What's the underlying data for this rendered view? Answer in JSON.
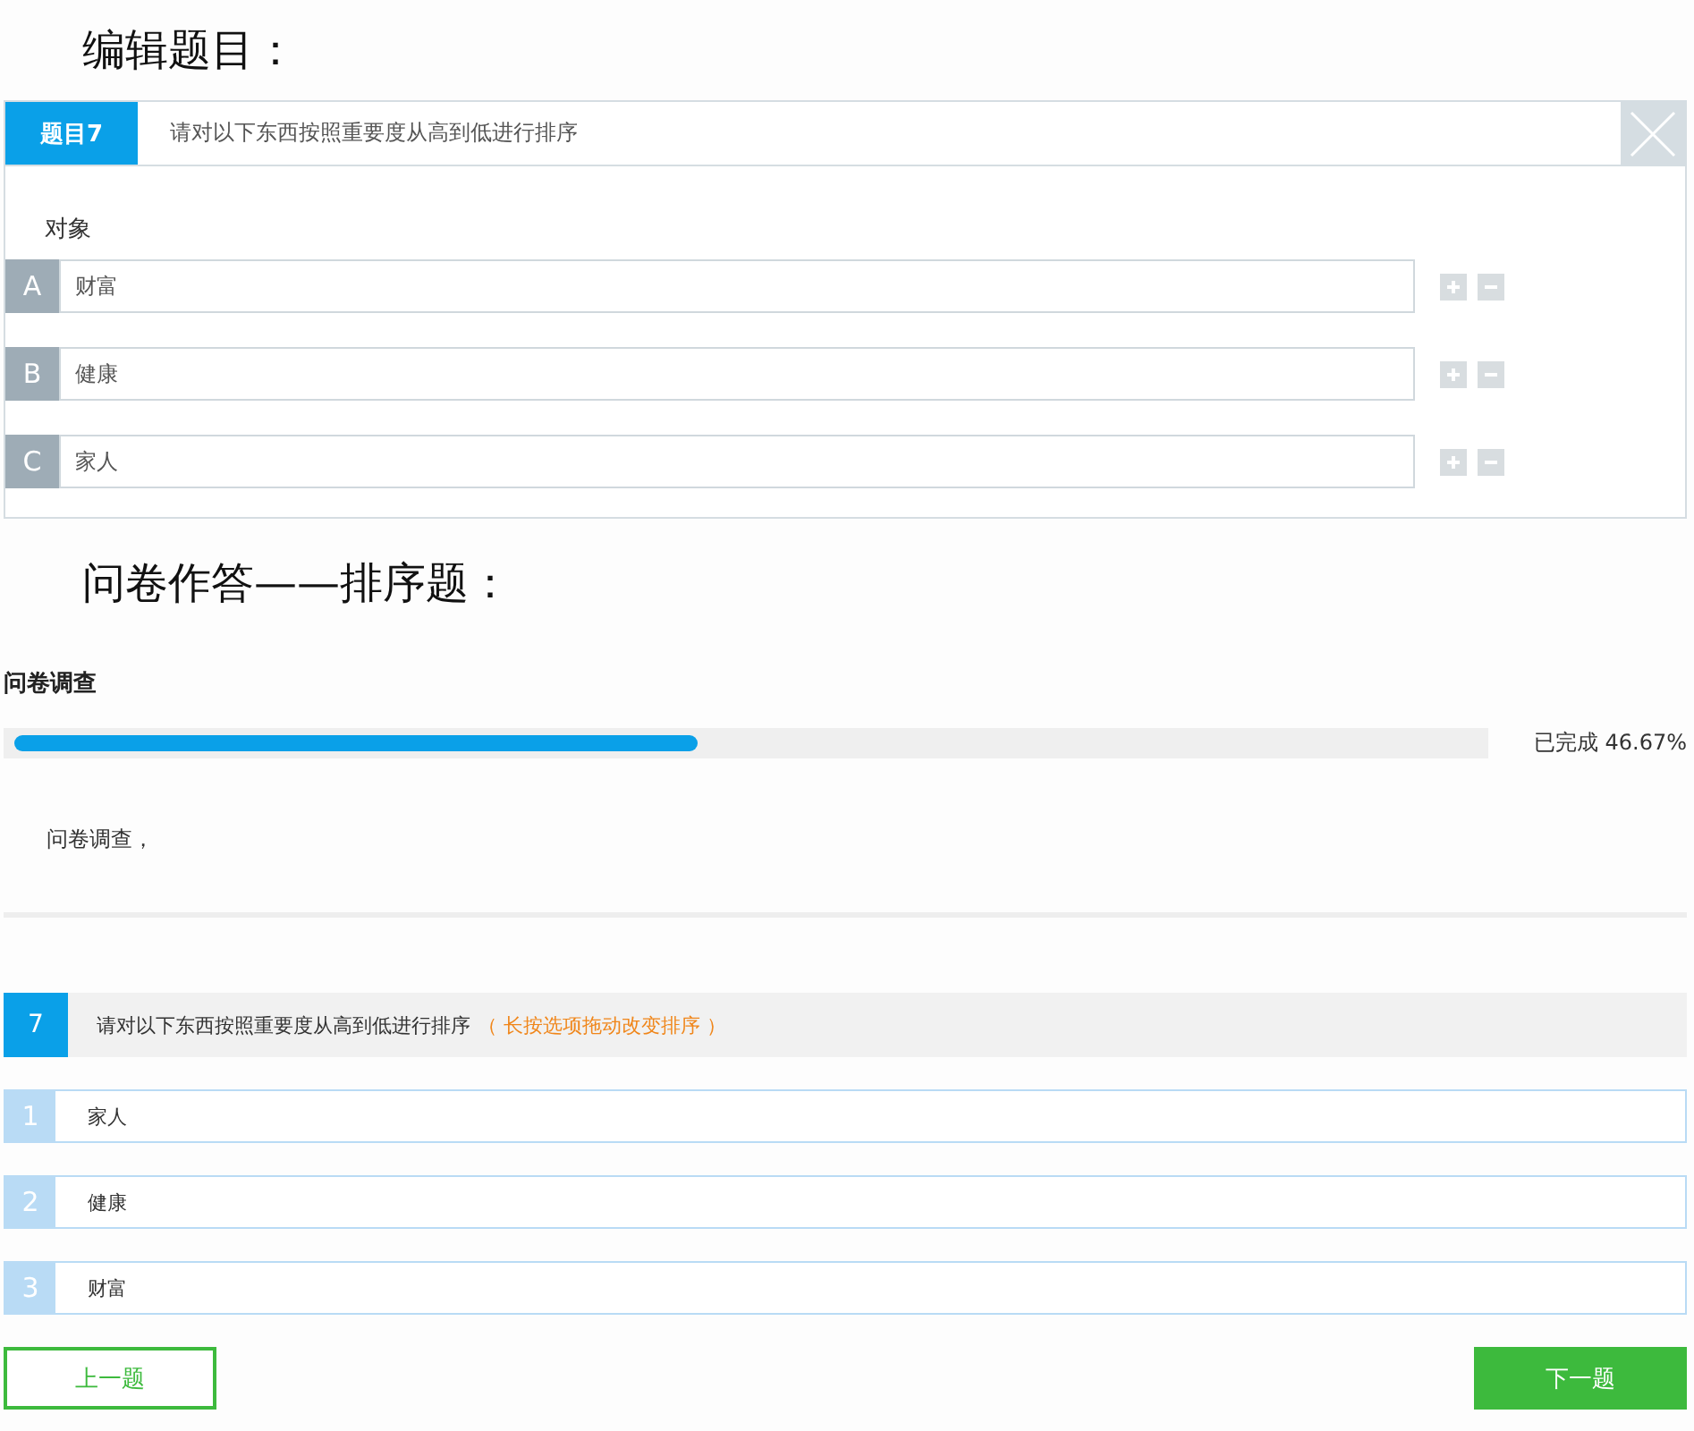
{
  "editor": {
    "heading": "编辑题目：",
    "question_tag": "题目7",
    "question_text": "请对以下东西按照重要度从高到低进行排序",
    "section_label": "对象",
    "options": [
      {
        "letter": "A",
        "value": "财富"
      },
      {
        "letter": "B",
        "value": "健康"
      },
      {
        "letter": "C",
        "value": "家人"
      }
    ]
  },
  "answer": {
    "heading": "问卷作答——排序题：",
    "survey_title": "问卷调查",
    "progress": {
      "level": 0.4667,
      "reading": "已完成 46.67%"
    },
    "intro": "问卷调查，",
    "question": {
      "number": "7",
      "text": "请对以下东西按照重要度从高到低进行排序",
      "hint": "（ 长按选项拖动改变排序 ）"
    },
    "ranks": [
      {
        "rank": "1",
        "label": "家人"
      },
      {
        "rank": "2",
        "label": "健康"
      },
      {
        "rank": "3",
        "label": "财富"
      }
    ],
    "buttons": [
      {
        "kind": "outline",
        "label": "上一题"
      },
      {
        "kind": "filled",
        "label": "下一题"
      }
    ]
  }
}
